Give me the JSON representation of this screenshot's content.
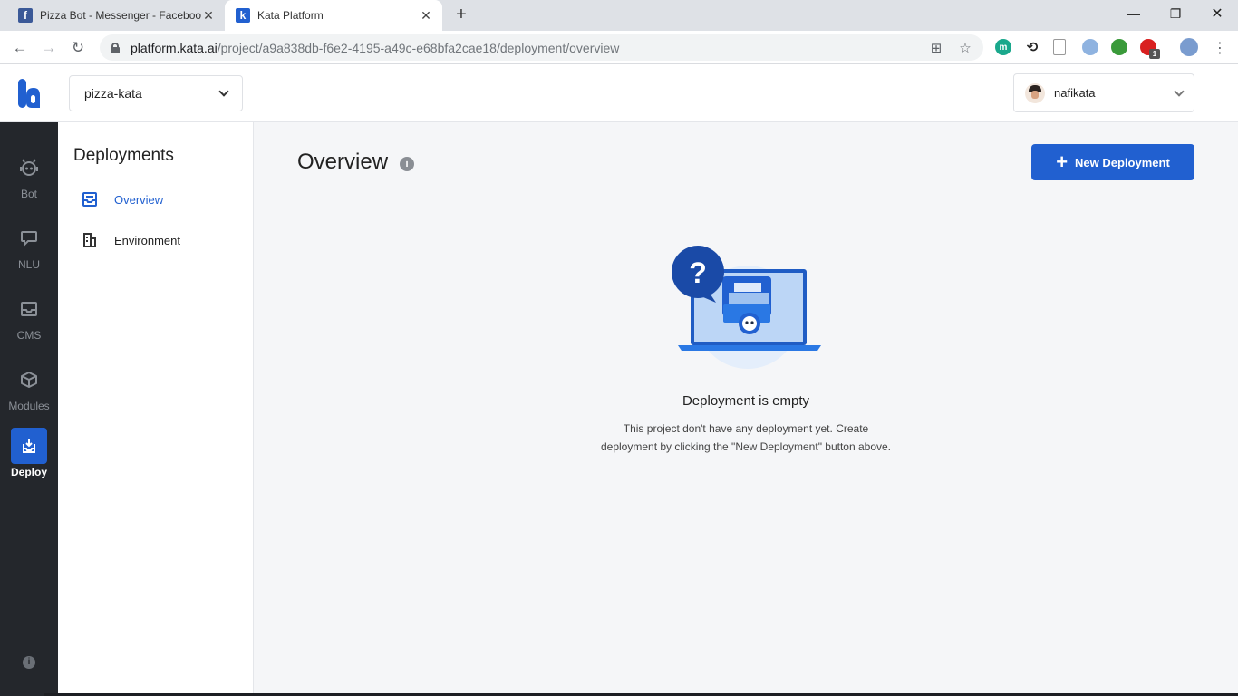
{
  "browser": {
    "tabs": [
      {
        "title": "Pizza Bot - Messenger - Faceboo",
        "favicon": "facebook-icon",
        "active": false
      },
      {
        "title": "Kata Platform",
        "favicon": "kata-icon",
        "active": true
      }
    ],
    "new_tab_label": "+",
    "url_host": "platform.kata.ai",
    "url_path": "/project/a9a838db-f6e2-4195-a49c-e68bfa2cae18/deployment/overview",
    "extension_badge": "1"
  },
  "header": {
    "project_name": "pizza-kata",
    "username": "nafikata"
  },
  "leftnav": {
    "items": [
      {
        "label": "Bot",
        "icon": "robot-icon"
      },
      {
        "label": "NLU",
        "icon": "chat-icon"
      },
      {
        "label": "CMS",
        "icon": "inbox-icon"
      },
      {
        "label": "Modules",
        "icon": "cube-icon"
      },
      {
        "label": "Deploy",
        "icon": "deploy-icon",
        "active": true
      }
    ],
    "info": "i"
  },
  "subnav": {
    "title": "Deployments",
    "items": [
      {
        "label": "Overview",
        "icon": "inbox-icon",
        "active": true
      },
      {
        "label": "Environment",
        "icon": "building-icon"
      }
    ]
  },
  "main": {
    "title": "Overview",
    "info": "i",
    "new_button_label": "New Deployment",
    "empty_title": "Deployment is empty",
    "empty_description": "This project don't have any deployment yet. Create deployment by clicking the \"New Deployment\" button above.",
    "illustration_mark": "?"
  },
  "colors": {
    "primary": "#2160d0",
    "nav_bg": "#24272c",
    "main_bg": "#f5f6f8"
  }
}
